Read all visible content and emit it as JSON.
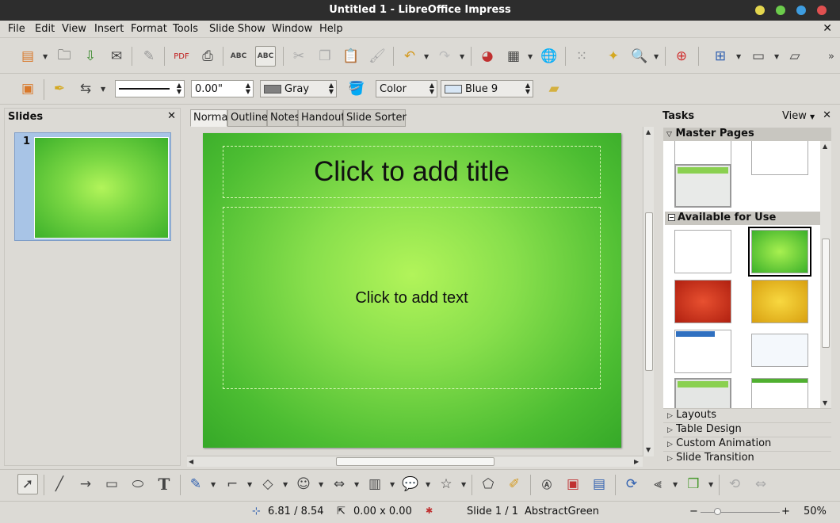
{
  "window": {
    "title": "Untitled 1 - LibreOffice Impress"
  },
  "menu": {
    "items": [
      "File",
      "Edit",
      "View",
      "Insert",
      "Format",
      "Tools",
      "Slide Show",
      "Window",
      "Help"
    ]
  },
  "line_props": {
    "width": "0.00\"",
    "area_style": "Gray",
    "area_type": "Color",
    "area_color": "Blue 9",
    "gray_color": "#808080",
    "blue_color": "#d7e6f5"
  },
  "slides_pane": {
    "title": "Slides",
    "slide_number": "1"
  },
  "view_tabs": [
    "Normal",
    "Outline",
    "Notes",
    "Handout",
    "Slide Sorter"
  ],
  "slide": {
    "title_placeholder": "Click to add title",
    "text_placeholder": "Click to add text"
  },
  "tasks": {
    "title": "Tasks",
    "view_label": "View",
    "master_pages": "Master Pages",
    "available": "Available for Use",
    "sections": [
      "Layouts",
      "Table Design",
      "Custom Animation",
      "Slide Transition"
    ]
  },
  "status": {
    "position": "6.81 / 8.54",
    "size": "0.00 x 0.00",
    "slide": "Slide 1 / 1",
    "master": "AbstractGreen",
    "zoom": "50%"
  }
}
